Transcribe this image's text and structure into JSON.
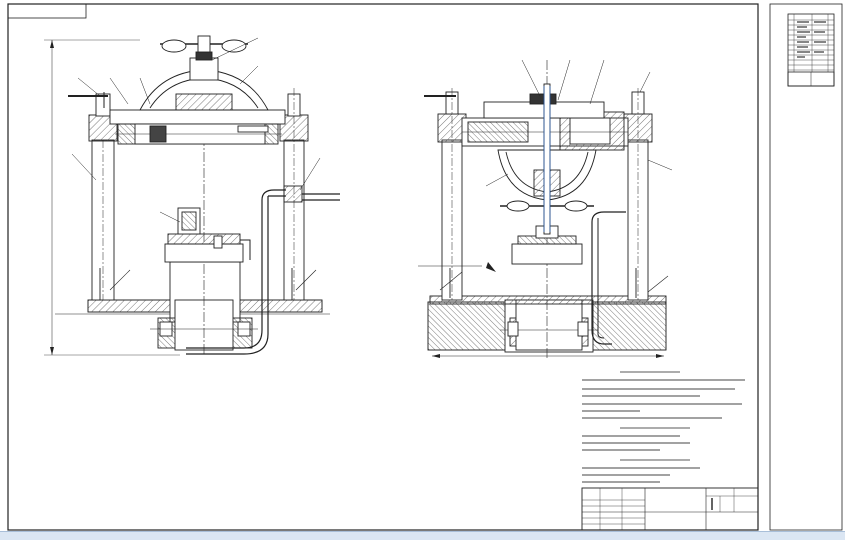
{
  "colors": {
    "line": "#222222",
    "hatch": "#555555",
    "accent_blue": "#2b5fa8",
    "sheet": "#ffffff"
  },
  "icons": {
    "arrow": "section-arrow-icon"
  }
}
